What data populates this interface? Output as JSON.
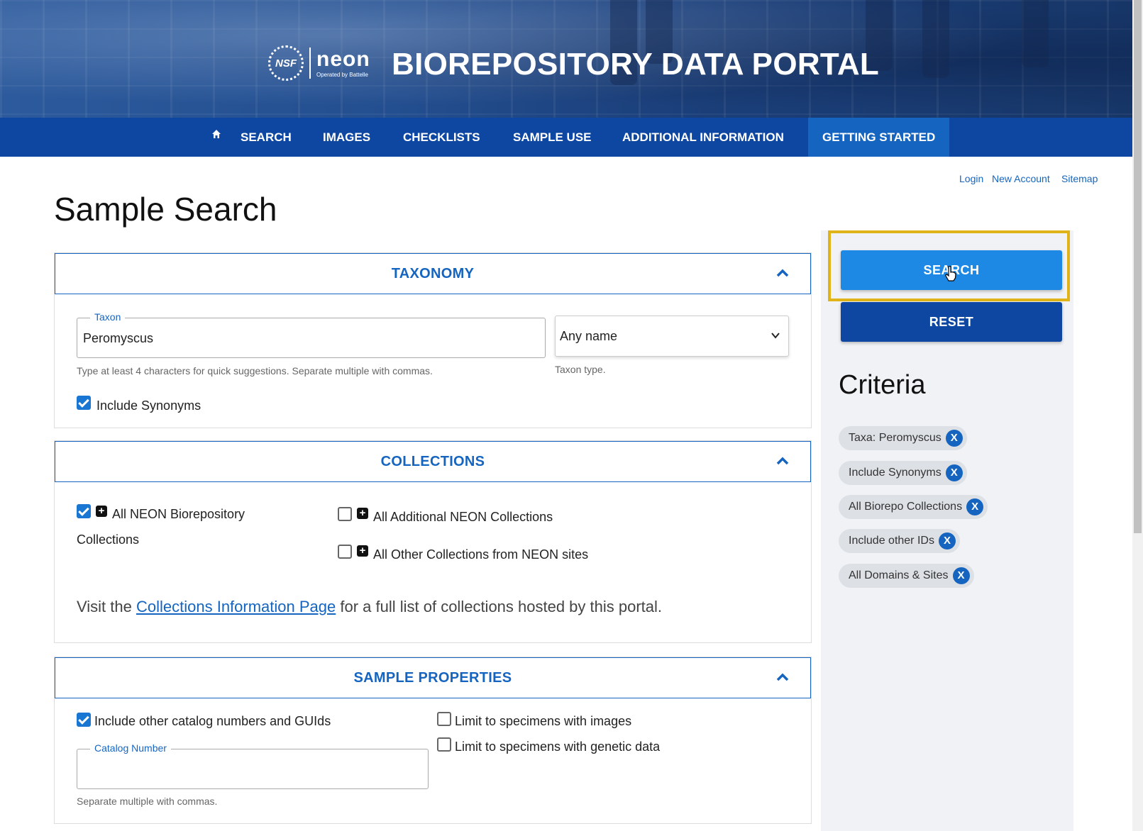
{
  "header": {
    "nsf_logo_text": "NSF",
    "neon_logo_text": "neon",
    "neon_logo_sub": "Operated by Battelle",
    "title": "BIOREPOSITORY DATA PORTAL"
  },
  "nav": {
    "items": [
      "SEARCH",
      "IMAGES",
      "CHECKLISTS",
      "SAMPLE USE",
      "ADDITIONAL INFORMATION",
      "GETTING STARTED"
    ],
    "active": "GETTING STARTED"
  },
  "account": {
    "login": "Login",
    "new_account": "New Account",
    "sitemap": "Sitemap"
  },
  "page_title": "Sample Search",
  "taxonomy": {
    "title": "TAXONOMY",
    "taxon_label": "Taxon",
    "taxon_value": "Peromyscus",
    "taxon_help": "Type at least 4 characters for quick suggestions. Separate multiple with commas.",
    "taxon_type_value": "Any name",
    "taxon_type_help": "Taxon type.",
    "include_synonyms": "Include Synonyms",
    "include_synonyms_checked": true
  },
  "collections": {
    "title": "COLLECTIONS",
    "all_neon_line1": "All NEON Biorepository",
    "all_neon_line2": "Collections",
    "all_neon_checked": true,
    "additional": "All Additional NEON Collections",
    "additional_checked": false,
    "other": "All Other Collections from NEON sites",
    "other_checked": false,
    "visit_prefix": "Visit the ",
    "visit_link": "Collections Information Page",
    "visit_suffix": " for a full list of collections hosted by this portal."
  },
  "sample_properties": {
    "title": "SAMPLE PROPERTIES",
    "include_other": "Include other catalog numbers and GUIds",
    "include_other_checked": true,
    "catalog_label": "Catalog Number",
    "catalog_value": "",
    "catalog_help": "Separate multiple with commas.",
    "limit_images": "Limit to specimens with images",
    "limit_images_checked": false,
    "limit_genetic": "Limit to specimens with genetic data",
    "limit_genetic_checked": false
  },
  "actions": {
    "search": "SEARCH",
    "reset": "RESET"
  },
  "criteria": {
    "title": "Criteria",
    "chips": [
      "Taxa: Peromyscus",
      "Include Synonyms",
      "All Biorepo Collections",
      "Include other IDs",
      "All Domains & Sites"
    ],
    "remove_label": "X"
  },
  "colors": {
    "nav": "#0d47a1",
    "accent": "#1565c0",
    "search_button": "#1e88e5",
    "highlight": "#e0b418"
  }
}
